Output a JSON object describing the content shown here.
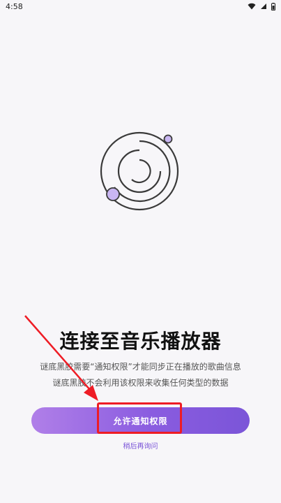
{
  "status_bar": {
    "time": "4:58",
    "icons": [
      "wifi-icon",
      "signal-icon",
      "battery-icon"
    ]
  },
  "illustration": {
    "name": "music-orbit-icon",
    "accent_color": "#c9b6f2",
    "stroke_color": "#3a3a3a"
  },
  "content": {
    "title": "连接至音乐播放器",
    "desc_line1": "谜底黑胶需要“通知权限”才能同步正在播放的歌曲信息",
    "desc_line2": "谜底黑胶不会利用该权限来收集任何类型的数据"
  },
  "actions": {
    "primary_label": "允许通知权限",
    "secondary_label": "稍后再询问"
  },
  "colors": {
    "primary_start": "#b07fe8",
    "primary_end": "#7b55d8",
    "annotation": "#ee1c25"
  }
}
